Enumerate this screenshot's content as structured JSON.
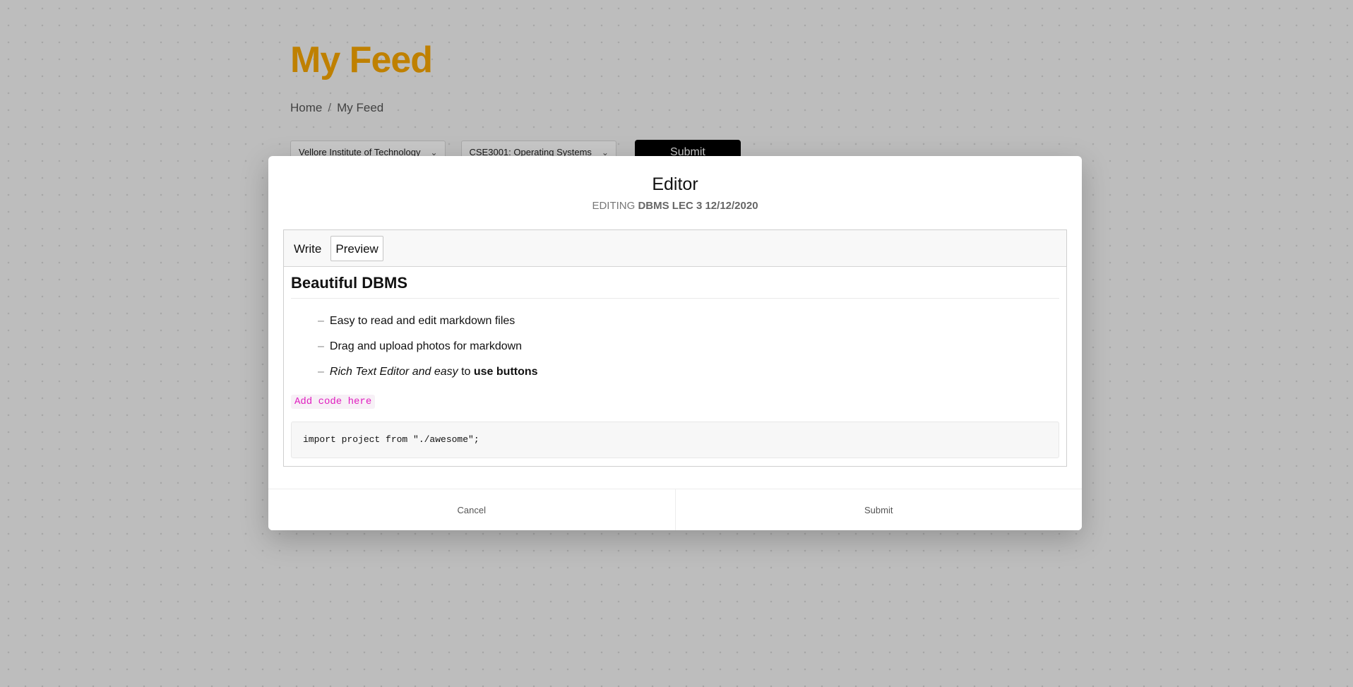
{
  "page": {
    "title": "My Feed",
    "breadcrumb": {
      "home": "Home",
      "separator": "/",
      "current": "My Feed"
    },
    "filters": {
      "institution": "Vellore Institute of Technology",
      "course": "CSE3001: Operating Systems",
      "submit_label": "Submit"
    }
  },
  "modal": {
    "title": "Editor",
    "subtitle_prefix": "EDITING",
    "subtitle_name": "DBMS LEC 3 12/12/2020",
    "tabs": {
      "write": "Write",
      "preview": "Preview",
      "active": "preview"
    },
    "preview": {
      "heading": "Beautiful DBMS",
      "list_bullet": "–",
      "items": [
        "Easy to read and edit markdown files",
        "Drag and upload photos for markdown"
      ],
      "rich_item": {
        "italic": "Rich Text Editor and easy",
        "middle": " to ",
        "bold": "use buttons"
      },
      "inline_code": "Add code here",
      "code_block": "import project from \"./awesome\";"
    },
    "footer": {
      "cancel_label": "Cancel",
      "submit_label": "Submit"
    }
  },
  "colors": {
    "accent": "#f5a400",
    "inline_code": "#e01dc0",
    "button_dark": "#000000"
  },
  "icons": {
    "select_chevron": "chevron-down-icon"
  }
}
